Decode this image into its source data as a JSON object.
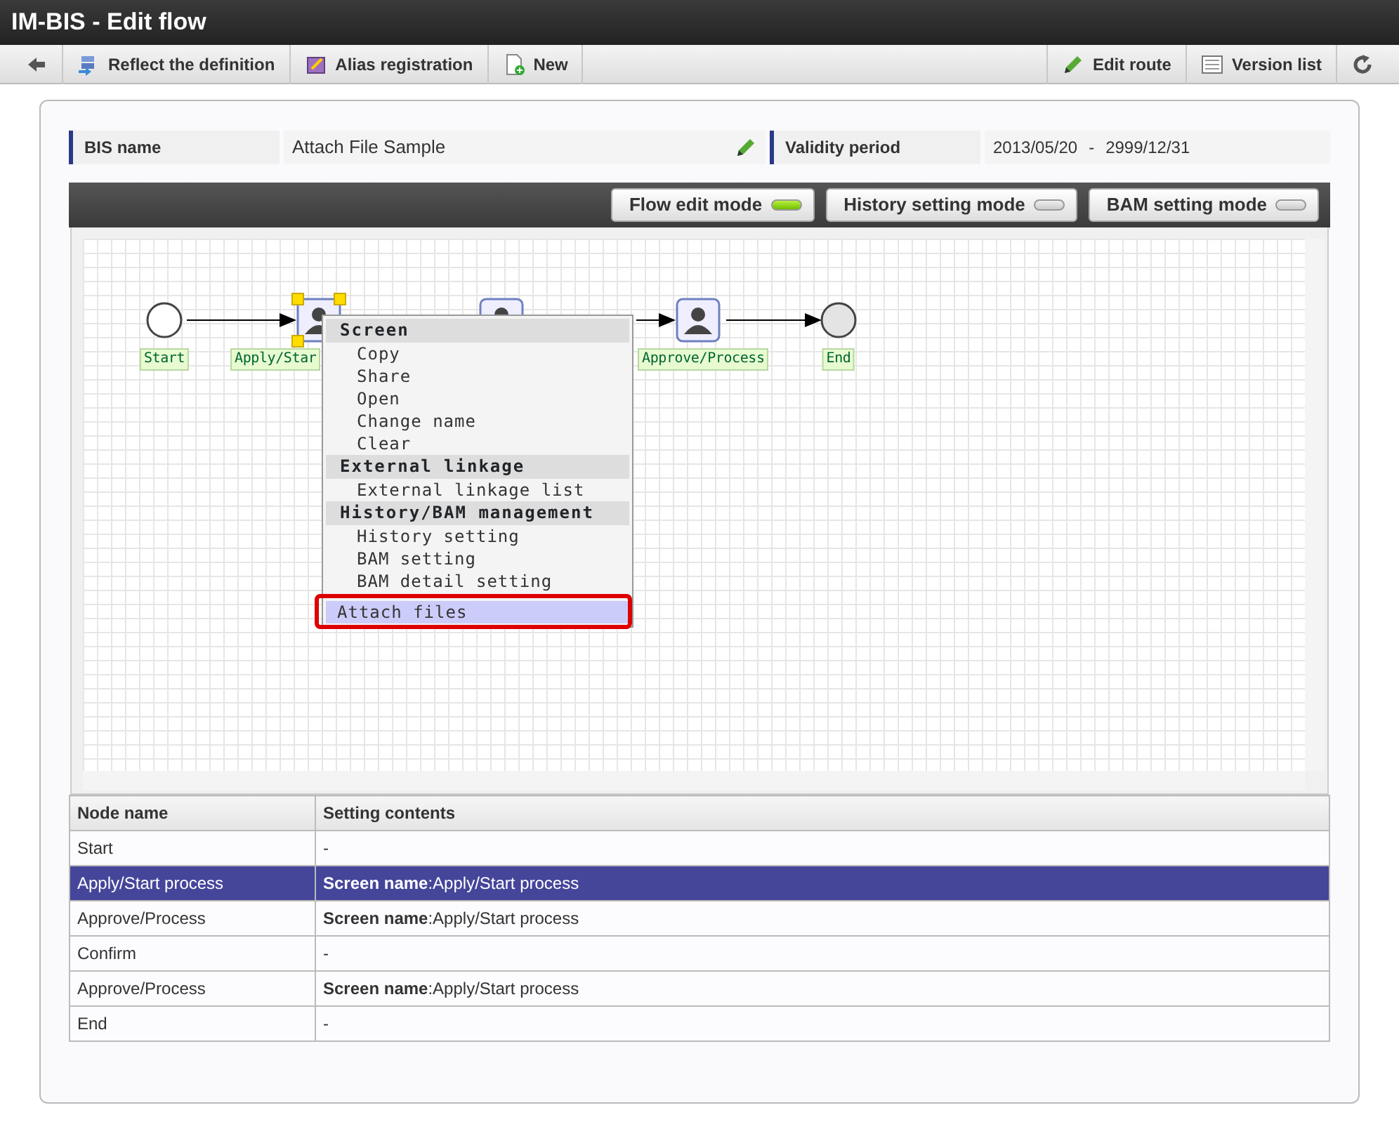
{
  "window": {
    "title": "IM-BIS - Edit flow"
  },
  "toolbar": {
    "left": [
      {
        "kind": "back"
      },
      {
        "kind": "reflect",
        "label": "Reflect the definition"
      },
      {
        "kind": "alias",
        "label": "Alias registration"
      },
      {
        "kind": "new",
        "label": "New"
      }
    ],
    "right": [
      {
        "kind": "edit",
        "label": "Edit route"
      },
      {
        "kind": "list",
        "label": "Version list"
      },
      {
        "kind": "refresh"
      }
    ]
  },
  "info": {
    "bis_name_label": "BIS name",
    "bis_name": "Attach File Sample",
    "validity_label": "Validity period",
    "validity_from": "2013/05/20",
    "validity_separator": "-",
    "validity_to": "2999/12/31"
  },
  "modes": [
    {
      "label": "Flow edit mode",
      "on": true
    },
    {
      "label": "History setting mode",
      "on": false
    },
    {
      "label": "BAM setting mode",
      "on": false
    }
  ],
  "flow": {
    "nodes": [
      {
        "kind": "start",
        "label": "Start",
        "selected": false
      },
      {
        "kind": "task",
        "label": "Apply/Star",
        "selected": true
      },
      {
        "kind": "task",
        "selected": false
      },
      {
        "kind": "task",
        "label": "Approve/Process",
        "selected": false
      },
      {
        "kind": "end",
        "label": "End",
        "selected": false
      }
    ]
  },
  "context_menu": [
    {
      "kind": "header",
      "label": "Screen"
    },
    {
      "kind": "item",
      "label": "Copy",
      "selected": false
    },
    {
      "kind": "item",
      "label": "Share",
      "selected": false
    },
    {
      "kind": "item",
      "label": "Open",
      "selected": false
    },
    {
      "kind": "item",
      "label": "Change name",
      "selected": false
    },
    {
      "kind": "item",
      "label": "Clear",
      "selected": false
    },
    {
      "kind": "header",
      "label": "External linkage"
    },
    {
      "kind": "item",
      "label": "External linkage list",
      "selected": false
    },
    {
      "kind": "header",
      "label": "History/BAM management"
    },
    {
      "kind": "item",
      "label": "History setting",
      "selected": false
    },
    {
      "kind": "item",
      "label": "BAM setting",
      "selected": false
    },
    {
      "kind": "item",
      "label": "BAM detail setting",
      "selected": false
    },
    {
      "kind": "item",
      "label": "Attach files",
      "selected": true
    }
  ],
  "table": {
    "columns": [
      "Node name",
      "Setting contents"
    ],
    "rows": [
      {
        "node_name": "Start",
        "setting": "-",
        "selected": false
      },
      {
        "node_name": "Apply/Start process",
        "setting": "**Screen name**:Apply/Start process",
        "selected": true
      },
      {
        "node_name": "Approve/Process",
        "setting": "**Screen name**:Apply/Start process",
        "selected": false
      },
      {
        "node_name": "Confirm",
        "setting": "-",
        "selected": false
      },
      {
        "node_name": "Approve/Process",
        "setting": "**Screen name**:Apply/Start process",
        "selected": false
      },
      {
        "node_name": "End",
        "setting": "-",
        "selected": false
      }
    ]
  }
}
